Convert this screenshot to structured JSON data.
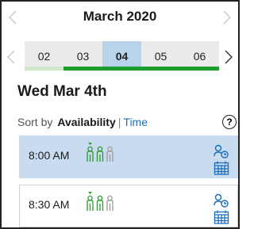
{
  "header": {
    "month_title": "March 2020"
  },
  "days": [
    {
      "label": "02",
      "bar_color": "#cfe6c8"
    },
    {
      "label": "03",
      "bar_color": "#1e9e2e"
    },
    {
      "label": "04",
      "bar_color": "#1e9e2e",
      "selected": true
    },
    {
      "label": "05",
      "bar_color": "#1e9e2e"
    },
    {
      "label": "06",
      "bar_color": "#1e9e2e"
    }
  ],
  "selected_date": "Wed Mar 4th",
  "sort": {
    "label": "Sort by",
    "active": "Availability",
    "separator": "|",
    "other": "Time",
    "help": "?"
  },
  "slots": [
    {
      "time": "8:00 AM",
      "available": 2,
      "total": 3,
      "selected": true
    },
    {
      "time": "8:30 AM",
      "available": 2,
      "total": 3,
      "selected": false
    }
  ],
  "colors": {
    "accent": "#1c6fb8",
    "available": "#2a9a2a",
    "unavailable": "#9a9a9a",
    "selected_bg": "#c9dcef"
  }
}
